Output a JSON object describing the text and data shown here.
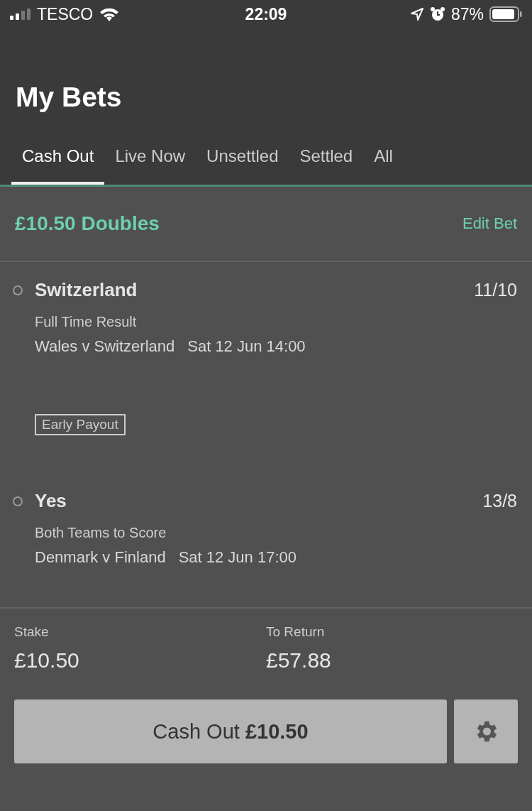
{
  "status_bar": {
    "carrier": "TESCO",
    "time": "22:09",
    "battery": "87%"
  },
  "title": "My Bets",
  "tabs": [
    {
      "label": "Cash Out",
      "selected": true
    },
    {
      "label": "Live Now",
      "selected": false
    },
    {
      "label": "Unsettled",
      "selected": false
    },
    {
      "label": "Settled",
      "selected": false
    },
    {
      "label": "All",
      "selected": false
    }
  ],
  "bet": {
    "title": "£10.50 Doubles",
    "edit": "Edit Bet",
    "legs": [
      {
        "selection": "Switzerland",
        "odds": "11/10",
        "market": "Full Time Result",
        "event": "Wales v Switzerland",
        "time": "Sat 12 Jun 14:00",
        "badge": "Early Payout"
      },
      {
        "selection": "Yes",
        "odds": "13/8",
        "market": "Both Teams to Score",
        "event": "Denmark v Finland",
        "time": "Sat 12 Jun 17:00"
      }
    ],
    "stake_label": "Stake",
    "stake": "£10.50",
    "return_label": "To Return",
    "return": "£57.88",
    "cash_out": "Cash Out **£10.50**"
  }
}
